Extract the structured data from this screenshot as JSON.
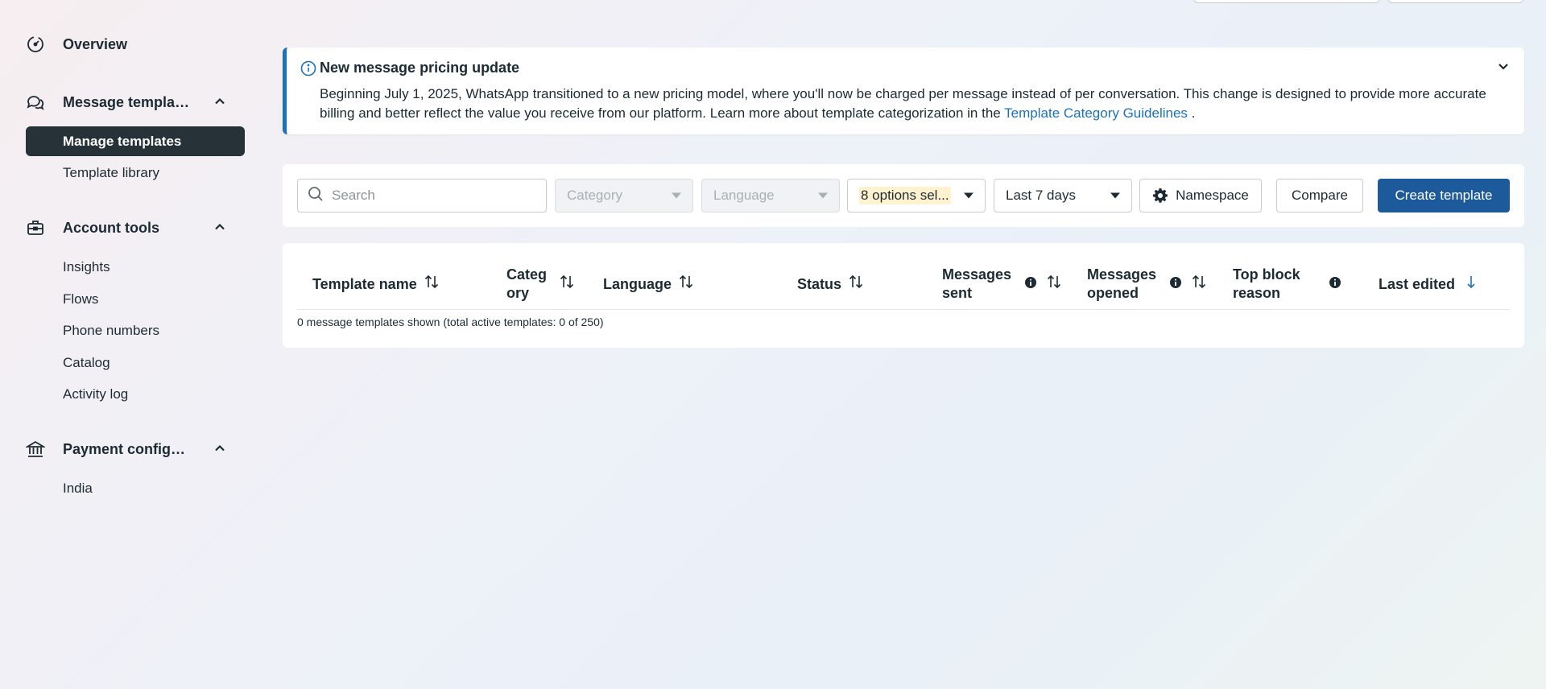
{
  "sidebar": {
    "overview": "Overview",
    "message_templates": {
      "label": "Message templates",
      "items": [
        "Manage templates",
        "Template library"
      ]
    },
    "account_tools": {
      "label": "Account tools",
      "items": [
        "Insights",
        "Flows",
        "Phone numbers",
        "Catalog",
        "Activity log"
      ]
    },
    "payment": {
      "label": "Payment configurations",
      "items": [
        "India"
      ]
    }
  },
  "banner": {
    "title": "New message pricing update",
    "text": "Beginning July 1, 2025, WhatsApp transitioned to a new pricing model, where you'll now be charged per message instead of per conversation. This change is designed to provide more accurate billing and better reflect the value you receive from our platform. Learn more about template categorization in the ",
    "link": "Template Category Guidelines",
    "tail": " ."
  },
  "filters": {
    "search_placeholder": "Search",
    "category_placeholder": "Category",
    "language_placeholder": "Language",
    "status_value": "8 options sel...",
    "date_value": "Last 7 days",
    "namespace": "Namespace",
    "compare": "Compare",
    "create": "Create template"
  },
  "table": {
    "columns": {
      "template_name": "Template name",
      "category_1": "Categ",
      "category_2": "ory",
      "language": "Language",
      "status": "Status",
      "sent_1": "Messages",
      "sent_2": "sent",
      "opened_1": "Messages",
      "opened_2": "opened",
      "block_1": "Top block",
      "block_2": "reason",
      "last_edited": "Last edited"
    },
    "summary": "0 message templates shown (total active templates: 0 of 250)"
  },
  "colors": {
    "accent": "#1d71b8",
    "primary_button": "#1d5a9b",
    "active_nav": "#263238"
  }
}
